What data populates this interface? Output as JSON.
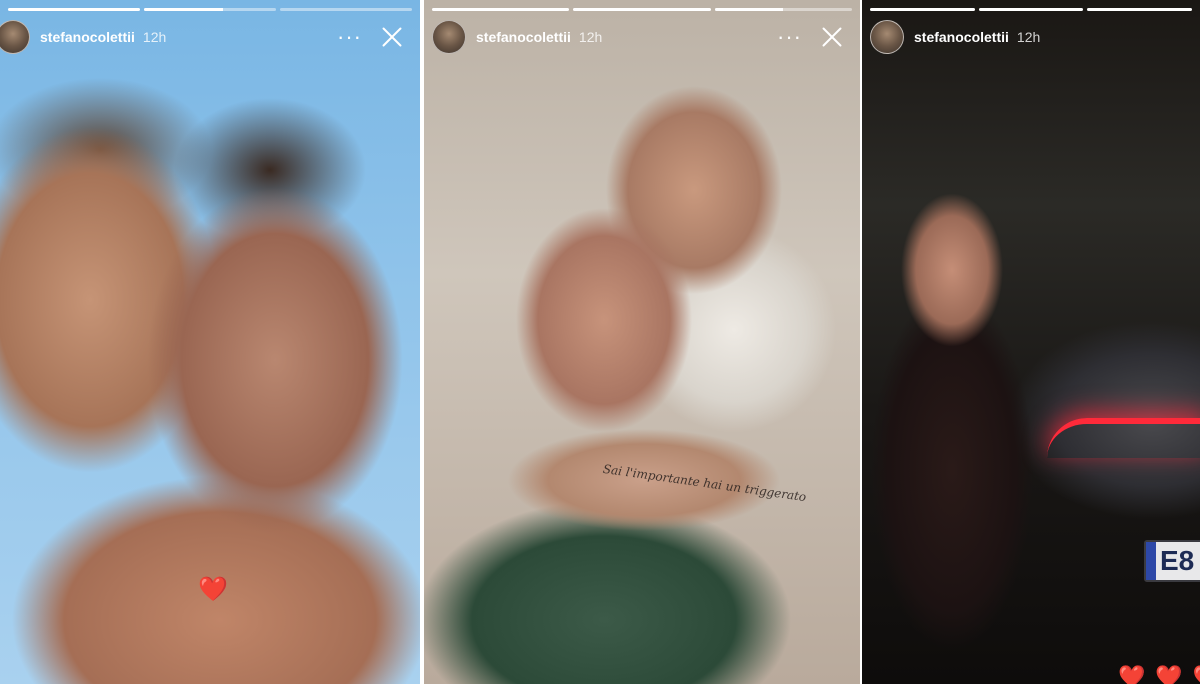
{
  "stories": [
    {
      "username": "stefanocolettii",
      "time": "12h",
      "more_label": "···",
      "heart": "❤️",
      "progress": [
        1,
        0.6,
        0
      ]
    },
    {
      "username": "stefanocolettii",
      "time": "12h",
      "more_label": "···",
      "tattoo": "Sai l'importante hai un triggerato",
      "progress": [
        1,
        1,
        0.5
      ]
    },
    {
      "username": "stefanocolettii",
      "time": "12h",
      "plate": "E8",
      "hearts": [
        "❤️",
        "❤️",
        "❤️"
      ],
      "progress": [
        1,
        1,
        1
      ]
    }
  ],
  "colors": {
    "story_text": "#ffffff",
    "heart": "#e6202e",
    "taillight": "#ff2a3a"
  },
  "icons": [
    "more-options-icon",
    "close-icon",
    "heart-icon"
  ]
}
